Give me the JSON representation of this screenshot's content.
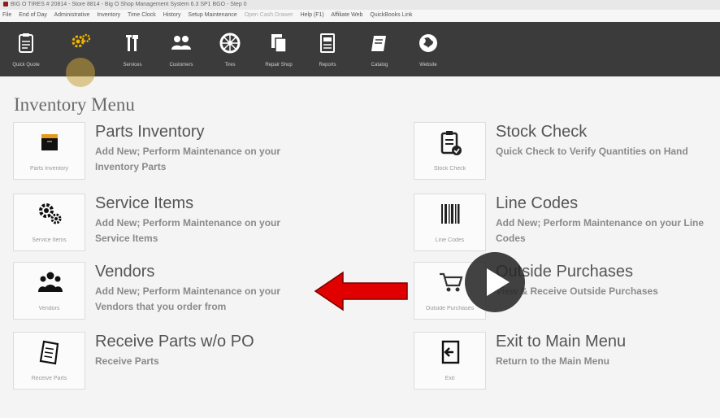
{
  "window": {
    "title": "BIG O TIRES # 20814 - Store 8814 - Big O Shop Management System 6.3 SP1 BGO - Step 0"
  },
  "menu": {
    "items": [
      "File",
      "End of Day",
      "Administrative",
      "Inventory",
      "Time Clock",
      "History",
      "Setup Maintenance"
    ],
    "dim_item": "Open Cash Drawer",
    "items_after": [
      "Help (F1)",
      "Affiliate Web",
      "QuickBooks Link"
    ]
  },
  "toolbar": {
    "buttons": [
      {
        "label": "Quick Quote",
        "icon": "clipboard-icon"
      },
      {
        "label": "",
        "icon": "gears-icon"
      },
      {
        "label": "Services",
        "icon": "wrench-icon"
      },
      {
        "label": "Customers",
        "icon": "people-icon"
      },
      {
        "label": "Tires",
        "icon": "tire-icon"
      },
      {
        "label": "Repair Shop",
        "icon": "documents-icon"
      },
      {
        "label": "Reports",
        "icon": "report-icon"
      },
      {
        "label": "Catalog",
        "icon": "catalog-icon"
      },
      {
        "label": "Website",
        "icon": "globe-icon"
      }
    ]
  },
  "page": {
    "title": "Inventory Menu"
  },
  "items": [
    {
      "tile_label": "Parts Inventory",
      "heading": "Parts Inventory",
      "desc": "Add New; Perform Maintenance on your Inventory Parts",
      "icon": "box-icon"
    },
    {
      "tile_label": "Stock Check",
      "heading": "Stock Check",
      "desc": "Quick Check to Verify Quantities on Hand",
      "icon": "checklist-icon"
    },
    {
      "tile_label": "Service Items",
      "heading": "Service Items",
      "desc": "Add New; Perform Maintenance on your Service Items",
      "icon": "gears-icon"
    },
    {
      "tile_label": "Line Codes",
      "heading": "Line Codes",
      "desc": "Add New; Perform Maintenance on your Line Codes",
      "icon": "barcode-icon"
    },
    {
      "tile_label": "Vendors",
      "heading": "Vendors",
      "desc": "Add New; Perform Maintenance on your Vendors that you order from",
      "icon": "group-icon"
    },
    {
      "tile_label": "Outside Purchases",
      "heading": "Outside Purchases",
      "desc": "View & Receive Outside Purchases",
      "icon": "cart-icon"
    },
    {
      "tile_label": "Receive Parts",
      "heading": "Receive Parts w/o PO",
      "desc": "Receive Parts",
      "icon": "receipt-icon"
    },
    {
      "tile_label": "Exit",
      "heading": "Exit to Main Menu",
      "desc": "Return to the Main Menu",
      "icon": "exit-icon"
    }
  ],
  "overlay": {
    "arrow_color": "#e00000",
    "play_icon": "play-icon"
  },
  "colors": {
    "toolbar_bg": "#3b3b3b",
    "accent": "#e00000"
  }
}
